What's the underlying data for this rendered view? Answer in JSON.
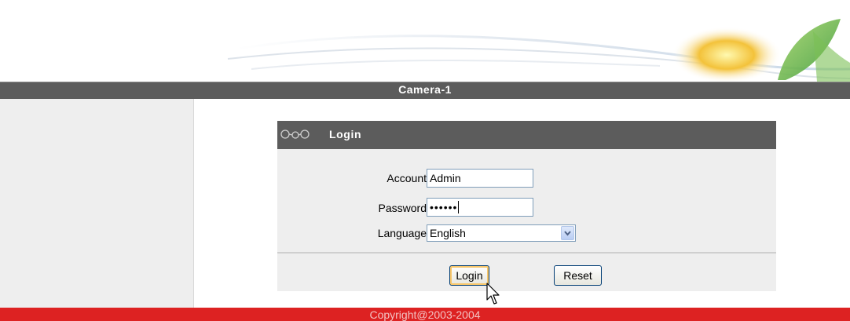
{
  "header": {
    "title": "Camera-1"
  },
  "login": {
    "title": "Login",
    "account_label": "Account",
    "account_value": "Admin",
    "password_label": "Password",
    "password_value": "••••••",
    "language_label": "Language",
    "language_value": "English",
    "login_button": "Login",
    "reset_button": "Reset"
  },
  "footer": {
    "copyright": "Copyright@2003-2004"
  },
  "colors": {
    "title_bar": "#5c5c5c",
    "footer": "#dd2222",
    "panel": "#eeeeee"
  },
  "icons": [
    "chain-link-icon",
    "dropdown-arrow-icon",
    "mouse-pointer-icon"
  ]
}
